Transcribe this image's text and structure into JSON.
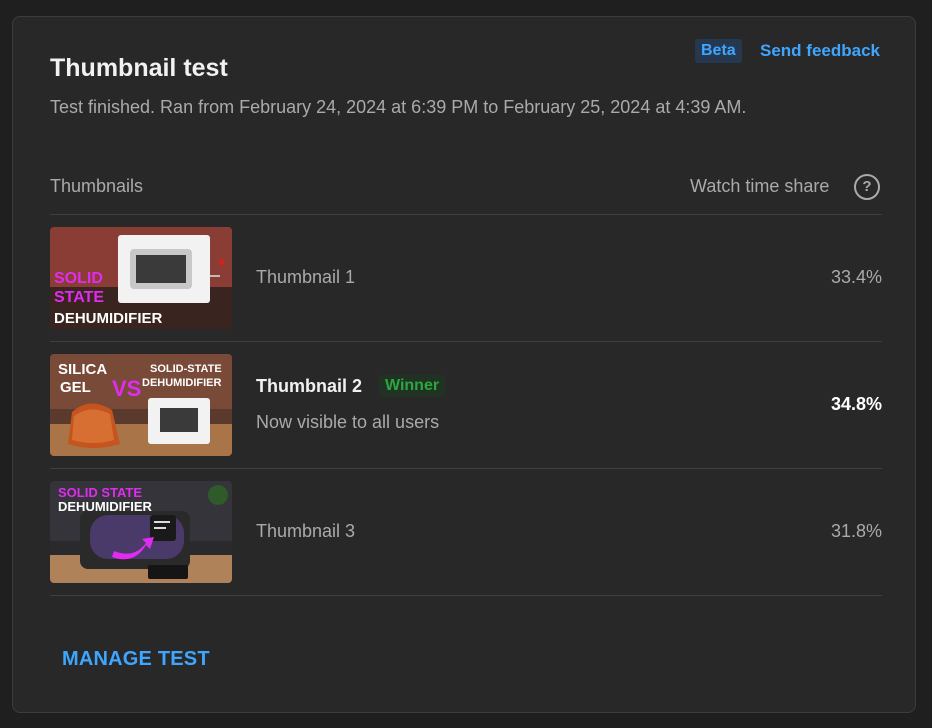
{
  "header": {
    "title": "Thumbnail test",
    "beta_label": "Beta",
    "feedback_label": "Send feedback",
    "subtitle": "Test finished. Ran from February 24, 2024 at 6:39 PM to February 25, 2024 at 4:39 AM."
  },
  "table": {
    "col_thumbnails": "Thumbnails",
    "col_watch_time": "Watch time share",
    "help_icon": "?"
  },
  "thumbnails": [
    {
      "label": "Thumbnail 1",
      "share": "33.4%",
      "overlay_text": [
        "SOLID",
        "STATE",
        "DEHUMIDIFIER"
      ]
    },
    {
      "label": "Thumbnail 2",
      "share": "34.8%",
      "winner_label": "Winner",
      "status": "Now visible to all users",
      "overlay_text": [
        "SILICA",
        "GEL",
        "VS",
        "SOLID-STATE",
        "DEHUMIDIFIER"
      ]
    },
    {
      "label": "Thumbnail 3",
      "share": "31.8%",
      "overlay_text": [
        "SOLID STATE",
        "DEHUMIDIFIER"
      ]
    }
  ],
  "footer": {
    "manage_label": "MANAGE TEST"
  },
  "colors": {
    "accent": "#3ea6ff",
    "winner": "#2ba640",
    "overlay_magenta": "#e02cf0"
  }
}
